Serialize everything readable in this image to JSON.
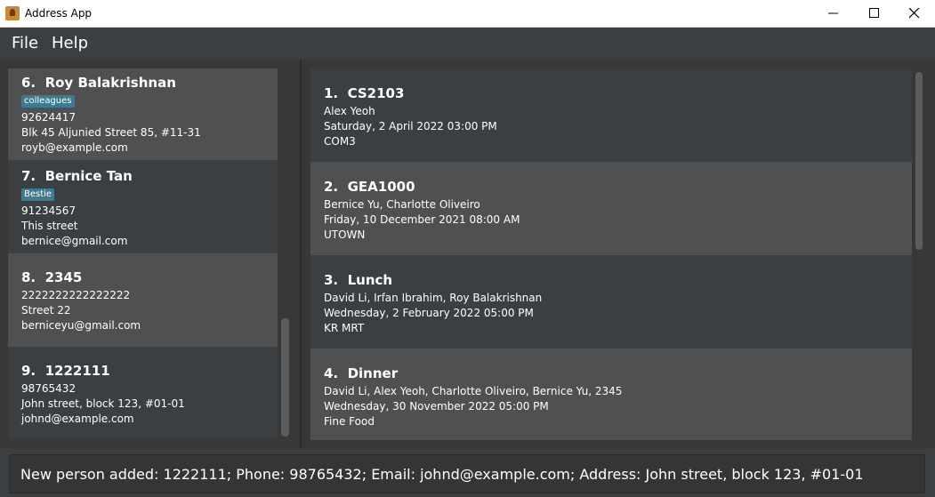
{
  "window": {
    "title": "Address App"
  },
  "menu": {
    "file": "File",
    "help": "Help"
  },
  "persons": [
    {
      "index": "6.",
      "name": "Roy Balakrishnan",
      "tag": "colleagues",
      "phone": "92624417",
      "address": "Blk 45 Aljunied Street 85, #11-31",
      "email": "royb@example.com"
    },
    {
      "index": "7.",
      "name": "Bernice Tan",
      "tag": "Bestie",
      "phone": "91234567",
      "address": "This street",
      "email": "bernice@gmail.com"
    },
    {
      "index": "8.",
      "name": "2345",
      "tag": "",
      "phone": "2222222222222222",
      "address": "Street 22",
      "email": "berniceyu@gmail.com"
    },
    {
      "index": "9.",
      "name": "1222111",
      "tag": "",
      "phone": "98765432",
      "address": "John street, block 123, #01-01",
      "email": "johnd@example.com"
    }
  ],
  "events": [
    {
      "index": "1.",
      "name": "CS2103",
      "participants": "Alex Yeoh",
      "datetime": "Saturday, 2 April 2022 03:00 PM",
      "location": "COM3"
    },
    {
      "index": "2.",
      "name": "GEA1000",
      "participants": "Bernice Yu, Charlotte Oliveiro",
      "datetime": "Friday, 10 December 2021 08:00 AM",
      "location": "UTOWN"
    },
    {
      "index": "3.",
      "name": "Lunch",
      "participants": "David Li, Irfan Ibrahim, Roy Balakrishnan",
      "datetime": "Wednesday, 2 February 2022 05:00 PM",
      "location": "KR MRT"
    },
    {
      "index": "4.",
      "name": "Dinner",
      "participants": "David Li, Alex Yeoh, Charlotte Oliveiro, Bernice Yu, 2345",
      "datetime": "Wednesday, 30 November 2022 05:00 PM",
      "location": "Fine Food"
    }
  ],
  "result": {
    "message": "New person added: 1222111; Phone: 98765432; Email: johnd@example.com; Address: John street, block 123, #01-01"
  },
  "colors": {
    "tag": "#3e7b91",
    "card_light": "#4f5052",
    "card_dark": "#3c3f41",
    "background": "#383838"
  }
}
